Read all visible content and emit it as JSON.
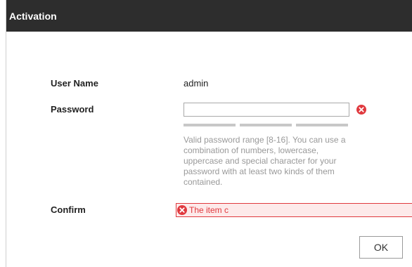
{
  "dialog": {
    "title": "Activation"
  },
  "form": {
    "username": {
      "label": "User Name",
      "value": "admin"
    },
    "password": {
      "label": "Password",
      "value": "",
      "error_icon": "error-circle-x-icon",
      "strength_segments": 3,
      "hint": "Valid password range [8-16]. You can use a combination of numbers, lowercase, uppercase and special character for your password with at least two kinds of them contained."
    },
    "confirm": {
      "label": "Confirm",
      "value": "",
      "error_icon": "error-circle-x-icon",
      "error_text": "The item c"
    }
  },
  "buttons": {
    "ok_label": "OK"
  },
  "colors": {
    "title_bar": "#2d2d2d",
    "error": "#e0393e",
    "error_bg": "#fdeaea",
    "hint_text": "#999999",
    "strength_bar": "#c8c8c8"
  }
}
